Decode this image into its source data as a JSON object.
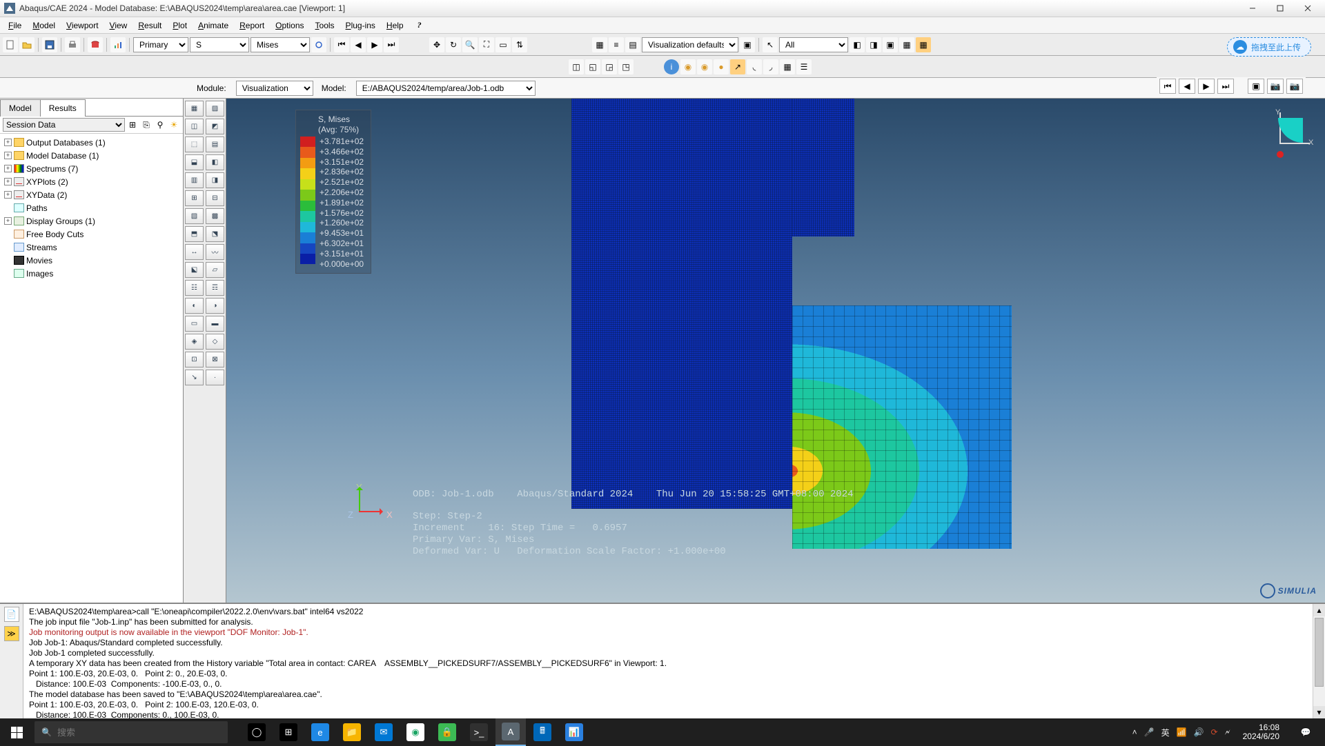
{
  "titlebar": {
    "text": "Abaqus/CAE 2024 - Model Database: E:\\ABAQUS2024\\temp\\area\\area.cae [Viewport: 1]"
  },
  "menubar": [
    "File",
    "Model",
    "Viewport",
    "View",
    "Result",
    "Plot",
    "Animate",
    "Report",
    "Options",
    "Tools",
    "Plug-ins",
    "Help"
  ],
  "help_q": "?",
  "toolbar1": {
    "primary_label": "Primary",
    "var_label": "S",
    "invariant_label": "Mises",
    "viz_label": "Visualization defaults",
    "all_label": "All"
  },
  "upload_pill": "拖拽至此上传",
  "context": {
    "module_label": "Module:",
    "module_value": "Visualization",
    "model_label": "Model:",
    "model_value": "E:/ABAQUS2024/temp/area/Job-1.odb"
  },
  "tabs": {
    "model": "Model",
    "results": "Results"
  },
  "session_label": "Session Data",
  "tree": {
    "odb": "Output Databases (1)",
    "mdl": "Model Database (1)",
    "spec": "Spectrums (7)",
    "xyplots": "XYPlots (2)",
    "xydata": "XYData (2)",
    "paths": "Paths",
    "dg": "Display Groups (1)",
    "fbc": "Free Body Cuts",
    "streams": "Streams",
    "movies": "Movies",
    "images": "Images"
  },
  "legend": {
    "title1": "S, Mises",
    "title2": "(Avg: 75%)",
    "colors": [
      "#d11f1f",
      "#e85a1b",
      "#f39c12",
      "#f4d018",
      "#c6e01a",
      "#7cc919",
      "#2bbd3b",
      "#1dc7a0",
      "#1fb8d9",
      "#1a7fd6",
      "#1646c0",
      "#0a1fa6"
    ],
    "values": [
      "+3.781e+02",
      "+3.466e+02",
      "+3.151e+02",
      "+2.836e+02",
      "+2.521e+02",
      "+2.206e+02",
      "+1.891e+02",
      "+1.576e+02",
      "+1.260e+02",
      "+9.453e+01",
      "+6.302e+01",
      "+3.151e+01",
      "+0.000e+00"
    ]
  },
  "hud": {
    "line1": "ODB: Job-1.odb    Abaqus/Standard 2024    Thu Jun 20 15:58:25 GMT+08:00 2024",
    "line2": "Step: Step-2",
    "line3": "Increment    16: Step Time =   0.6957",
    "line4": "Primary Var: S, Mises",
    "line5": "Deformed Var: U   Deformation Scale Factor: +1.000e+00"
  },
  "triad": {
    "x": "X",
    "y": "Y",
    "z": "Z"
  },
  "simulia": "SIMULIA",
  "console": [
    {
      "t": "E:\\ABAQUS2024\\temp\\area>call \"E:\\oneapi\\compiler\\2022.2.0\\env\\vars.bat\" intel64 vs2022",
      "c": ""
    },
    {
      "t": "The job input file \"Job-1.inp\" has been submitted for analysis.",
      "c": ""
    },
    {
      "t": "Job monitoring output is now available in the viewport \"DOF Monitor: Job-1\".",
      "c": "red"
    },
    {
      "t": "Job Job-1: Abaqus/Standard completed successfully.",
      "c": ""
    },
    {
      "t": "Job Job-1 completed successfully.",
      "c": ""
    },
    {
      "t": "A temporary XY data has been created from the History variable \"Total area in contact: CAREA    ASSEMBLY__PICKEDSURF7/ASSEMBLY__PICKEDSURF6\" in Viewport: 1.",
      "c": ""
    },
    {
      "t": "",
      "c": ""
    },
    {
      "t": "Point 1: 100.E-03, 20.E-03, 0.   Point 2: 0., 20.E-03, 0.",
      "c": ""
    },
    {
      "t": "   Distance: 100.E-03  Components: -100.E-03, 0., 0.",
      "c": ""
    },
    {
      "t": "The model database has been saved to \"E:\\ABAQUS2024\\temp\\area\\area.cae\".",
      "c": ""
    },
    {
      "t": "",
      "c": ""
    },
    {
      "t": "Point 1: 100.E-03, 20.E-03, 0.   Point 2: 100.E-03, 120.E-03, 0.",
      "c": ""
    },
    {
      "t": "   Distance: 100.E-03  Components: 0., 100.E-03, 0.",
      "c": ""
    }
  ],
  "taskbar": {
    "search_placeholder": "搜索",
    "apps": [
      {
        "bg": "#000",
        "txt": "◯"
      },
      {
        "bg": "#000",
        "txt": "⊞"
      },
      {
        "bg": "#1e88e5",
        "txt": "e"
      },
      {
        "bg": "#f7b500",
        "txt": "📁"
      },
      {
        "bg": "#0078d4",
        "txt": "✉"
      },
      {
        "bg": "#ffffff",
        "txt": "◉",
        "fg": "#19a463"
      },
      {
        "bg": "#3cba54",
        "txt": "🔒"
      },
      {
        "bg": "#303030",
        "txt": ">_"
      },
      {
        "bg": "#5b6770",
        "txt": "A",
        "active": true
      },
      {
        "bg": "#0067b8",
        "txt": "🖩"
      },
      {
        "bg": "#2a80e0",
        "txt": "📊"
      }
    ],
    "clock_time": "16:08",
    "clock_date": "2024/6/20"
  },
  "chart_data": {
    "type": "contour",
    "title": "S, Mises (Avg: 75%)",
    "field": "S, Mises",
    "averaging_pct": 75,
    "range": [
      0.0,
      378.1
    ],
    "contour_levels": [
      0.0,
      31.51,
      63.02,
      94.53,
      126.0,
      157.6,
      189.1,
      220.6,
      252.1,
      283.6,
      315.1,
      346.6,
      378.1
    ],
    "step": "Step-2",
    "increment": 16,
    "step_time": 0.6957,
    "deformation_scale_factor": 1.0
  }
}
